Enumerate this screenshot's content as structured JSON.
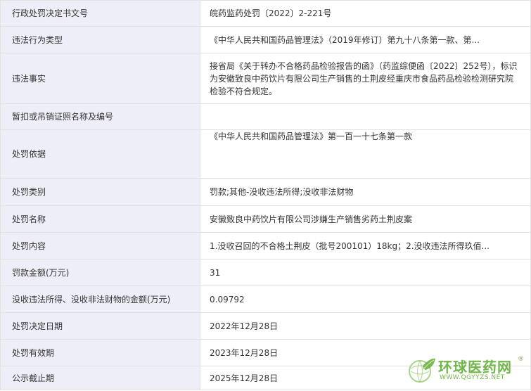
{
  "rows": [
    {
      "label": "行政处罚决定书文号",
      "value": "皖药监药处罚〔2022〕2-221号"
    },
    {
      "label": "违法行为类型",
      "value": "《中华人民共和国药品管理法》（2019年修订）第九十八条第一款、第..."
    },
    {
      "label": "违法事实",
      "value": "接省局《关于转办不合格药品检验报告的函》（药监综便函〔2022〕252号），标识为安徽致良中药饮片有限公司生产销售的土荆皮经重庆市食品药品检验检测研究院检验不符合规定。"
    },
    {
      "label": "暂扣或吊销证照名称及编号",
      "value": ""
    },
    {
      "label": "处罚依据",
      "value": "《中华人民共和国药品管理法》第一百一十七条第一款"
    },
    {
      "label": "处罚类别",
      "value": "罚款;其他-没收违法所得;没收非法财物"
    },
    {
      "label": "处罚名称",
      "value": "安徽致良中药饮片有限公司涉嫌生产销售劣药土荆皮案"
    },
    {
      "label": "处罚内容",
      "value": "1.没收召回的不合格土荆皮（批号200101）18kg；2.没收违法所得玖佰..."
    },
    {
      "label": "罚款金额(万元)",
      "value": "31"
    },
    {
      "label": "没收违法所得、没收非法财物的金额(万元)",
      "value": "0.09792"
    },
    {
      "label": "处罚决定日期",
      "value": "2022年12月28日"
    },
    {
      "label": "处罚有效期",
      "value": "2023年12月28日"
    },
    {
      "label": "公示截止期",
      "value": "2025年12月28日"
    }
  ],
  "watermark": {
    "title": "环球医药网",
    "url": "WWW.QGYYZS.NET",
    "reg": "®",
    "color": "#72b64a"
  }
}
